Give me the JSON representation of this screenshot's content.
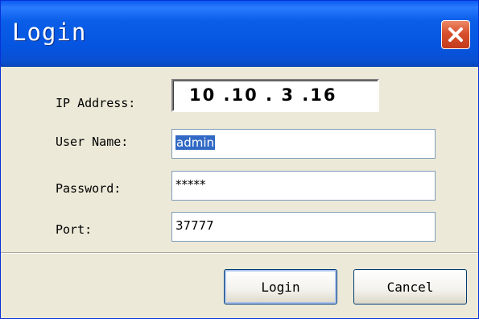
{
  "window": {
    "title": "Login",
    "close_icon": "close-icon"
  },
  "form": {
    "ip_label": "IP Address:",
    "ip_value": "10 .10 . 3 .16",
    "username_label": "User Name:",
    "username_value": "admin",
    "password_label": "Password:",
    "password_value": "*****",
    "port_label": "Port:",
    "port_value": "37777"
  },
  "buttons": {
    "login_label": "Login",
    "cancel_label": "Cancel"
  },
  "colors": {
    "titlebar": "#0554e0",
    "close_button": "#d9502d",
    "dialog_face": "#ece9d8",
    "selection": "#316ac5"
  }
}
